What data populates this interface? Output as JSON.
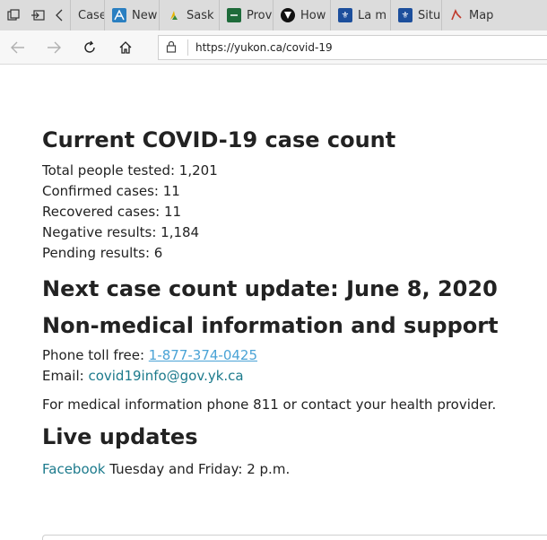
{
  "tabs": [
    {
      "label": "Case",
      "icon": "generic-page-icon"
    },
    {
      "label": "New",
      "icon": "phac-logo-icon"
    },
    {
      "label": "Sask",
      "icon": "saskatchewan-logo-icon"
    },
    {
      "label": "Prov",
      "icon": "provincial-site-icon"
    },
    {
      "label": "How",
      "icon": "shield-logo-icon"
    },
    {
      "label": "La m",
      "icon": "quebec-fleur-de-lis-icon"
    },
    {
      "label": "Situ",
      "icon": "quebec-fleur-de-lis-icon"
    },
    {
      "label": "Map",
      "icon": "map-site-icon"
    }
  ],
  "address": {
    "url": "https://yukon.ca/covid-19"
  },
  "case_count": {
    "heading": "Current COVID-19 case count",
    "total_tested": "Total people tested: 1,201",
    "confirmed": "Confirmed cases: 11",
    "recovered": "Recovered cases: 11",
    "negative": "Negative results: 1,184",
    "pending": "Pending results: 6"
  },
  "next_update": {
    "heading": "Next case count update: June 8, 2020"
  },
  "support": {
    "heading": "Non-medical information and support",
    "phone_label": "Phone toll free: ",
    "phone_number": "1-877-374-0425",
    "email_label": "Email: ",
    "email": "covid19info@gov.yk.ca",
    "medical_note": "For medical information phone 811 or contact your health provider."
  },
  "live": {
    "heading": "Live updates",
    "facebook_link": "Facebook",
    "schedule": " Tuesday and Friday: 2 p.m."
  }
}
